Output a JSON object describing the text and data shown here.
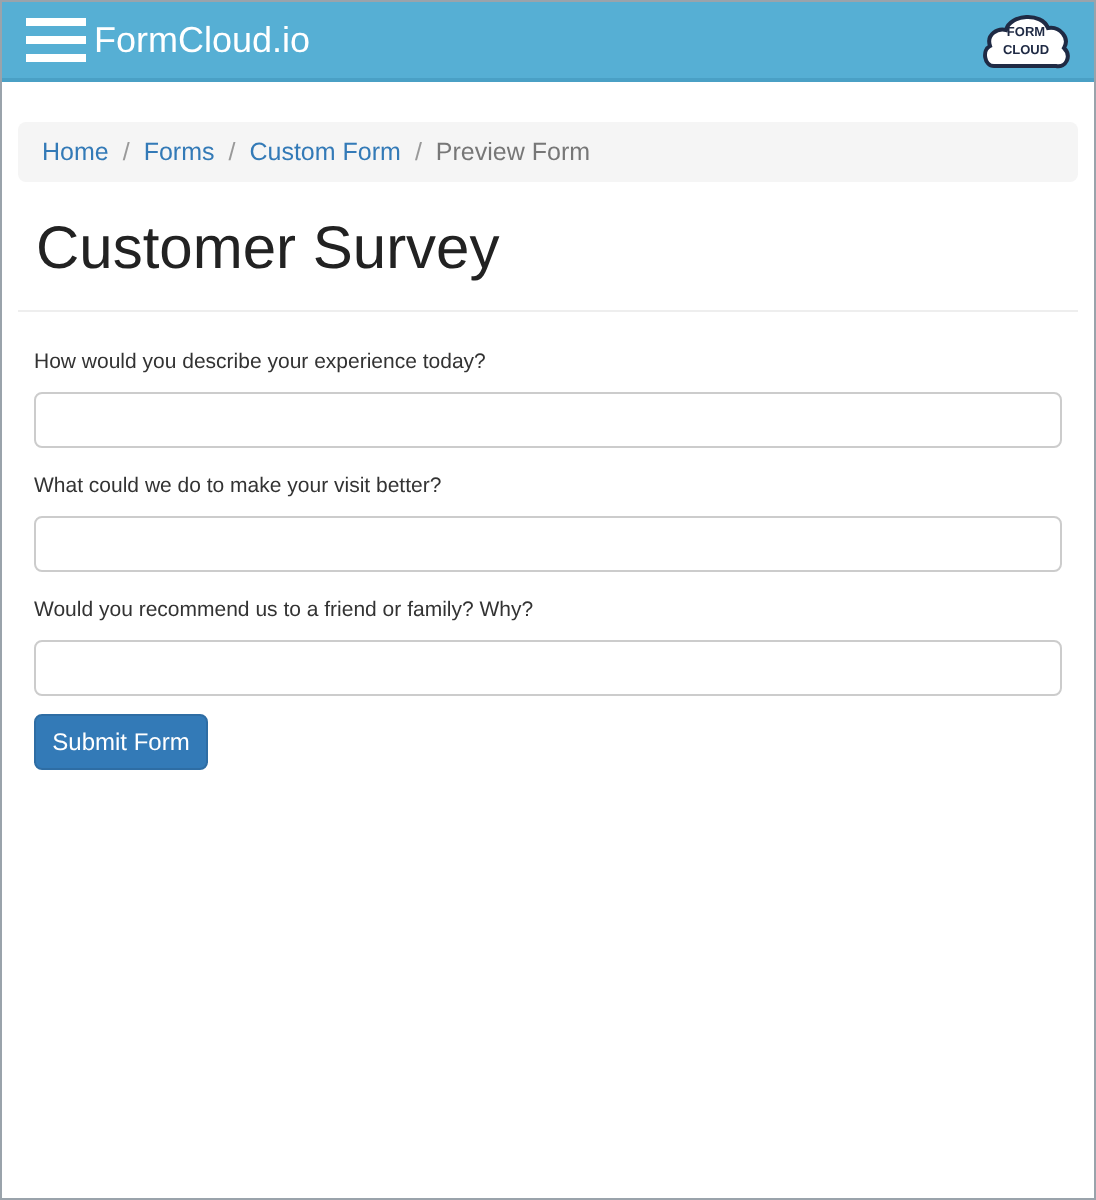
{
  "header": {
    "brand": "FormCloud.io",
    "logo_lines": [
      "FORM",
      "CLOUD"
    ]
  },
  "breadcrumb": [
    {
      "label": "Home",
      "current": false
    },
    {
      "label": "Forms",
      "current": false,
      "separator_before": "/"
    },
    {
      "label": "Custom Form",
      "current": false,
      "separator_before": "/"
    },
    {
      "label": "Preview Form",
      "current": true,
      "separator_before": "/"
    }
  ],
  "title": "Customer Survey",
  "questions": [
    {
      "label": "How would you describe your experience today?"
    },
    {
      "label": "What could we do to make your visit better?"
    },
    {
      "label": "Would you recommend us to a friend or family? Why?"
    }
  ],
  "submit": "Submit Form"
}
